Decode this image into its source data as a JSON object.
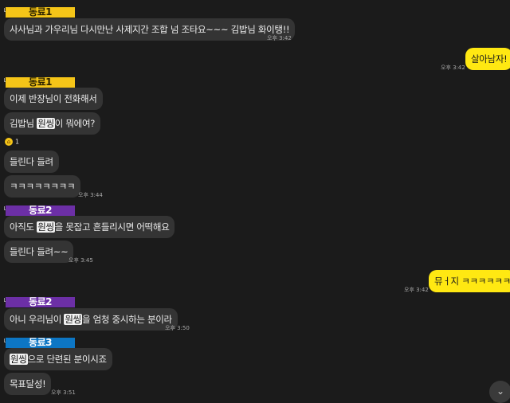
{
  "messages": {
    "g1_sender": "동료1",
    "m1": "사사님과 가우리님 다시만난 사제지간 조합 넘 조타요~~~ 김밥님 화이탱!!",
    "m1_time": "오후 3:42",
    "mine1": "살아남자!",
    "mine1_time": "오후 3:42",
    "g2_sender": "동료1",
    "m2": "이제 반장님이 전화해서",
    "m3_pre": "김밥님 ",
    "m3_hl": "원씽",
    "m3_post": "이 뭐에여?",
    "reaction_count": "1",
    "m4": "들린다 들려",
    "m5": "ㅋㅋㅋㅋㅋㅋㅋㅋ",
    "m5_time": "오후 3:44",
    "g3_sender": "동료2",
    "m6_pre": "아직도 ",
    "m6_hl": "원씽",
    "m6_post": "을 못잡고 흔들리시면 어떡해요",
    "m7": "들린다 들려~~",
    "m7_time": "오후 3:45",
    "mine2": "뮤ㅓ지 ㅋㅋㅋㅋㅋㅋ",
    "mine2_time": "오후 3:42",
    "g4_sender": "동료2",
    "m8_pre": "아니 우리님이 ",
    "m8_hl": "원씽",
    "m8_post": "을 엄청 중시하는 분이라",
    "m8_time": "오후 3:50",
    "g5_sender": "동료3",
    "m9_hl": "원씽",
    "m9_post": "으로 단련된 분이시죠",
    "m10": "목표달성!",
    "m10_time": "오후 3:51"
  },
  "icons": {
    "reaction": "laughing-face-emoji",
    "scroll_down": "chevron-down-icon"
  },
  "colors": {
    "background": "#1b1b1b",
    "bubble_other": "#343434",
    "bubble_mine": "#ffe812",
    "tag_1": "#f5c518",
    "tag_2": "#6c2fa6",
    "tag_3": "#0d76c4"
  }
}
